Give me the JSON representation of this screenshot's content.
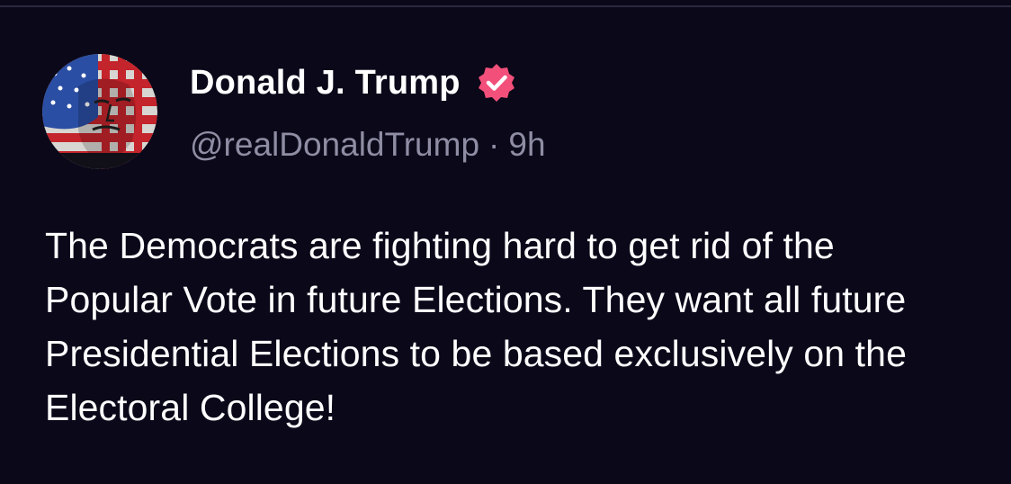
{
  "post": {
    "author": {
      "display_name": "Donald J. Trump",
      "handle": "@realDonaldTrump",
      "verified": true,
      "avatar_icon": "american-flag-face-portrait"
    },
    "separator": "·",
    "time_ago": "9h",
    "text": "The Democrats are fighting hard to get rid of the Popular Vote in future Elections. They want all future Presidential Elections to be based exclusively on the Electoral College!"
  },
  "colors": {
    "background": "#0b0819",
    "text_primary": "#ffffff",
    "text_secondary": "#8f8da3",
    "verified_badge": "#f2507a",
    "divider": "#2a2740"
  }
}
